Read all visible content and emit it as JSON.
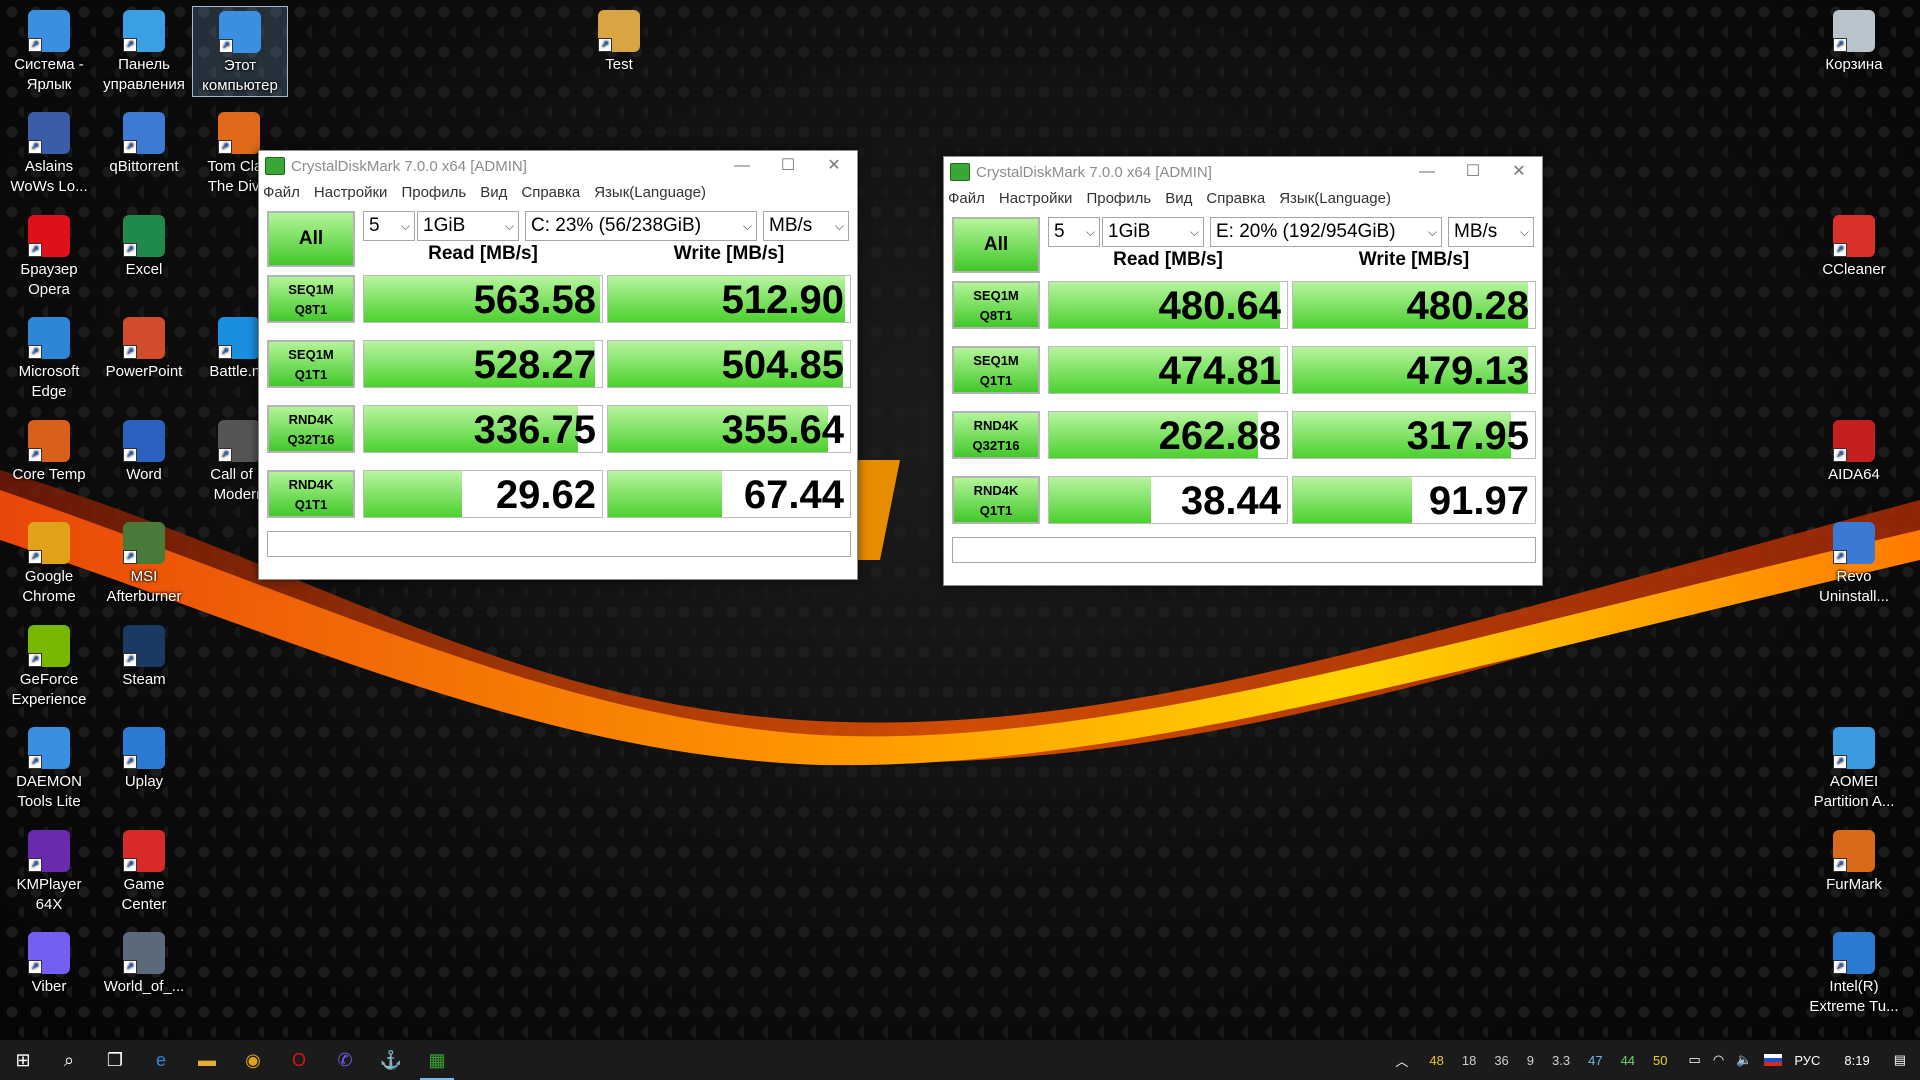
{
  "desktop": {
    "icons": [
      {
        "label": "Система - Ярлык",
        "icon": "computer-icon",
        "color": "#3b8fe0"
      },
      {
        "label": "Панель управления",
        "icon": "control-panel-icon",
        "color": "#3aa0e6"
      },
      {
        "label": "Этот компьютер",
        "icon": "this-pc-icon",
        "color": "#3b8fe0"
      },
      {
        "label": "Test",
        "icon": "folder-icon",
        "color": "#d9a441"
      },
      {
        "label": "Корзина",
        "icon": "recycle-bin-icon",
        "color": "#b9c4cc"
      },
      {
        "label": "Aslains WoWs Lo...",
        "icon": "aslains-icon",
        "color": "#3b5da8"
      },
      {
        "label": "qBittorrent",
        "icon": "qbittorrent-icon",
        "color": "#3b7bd4"
      },
      {
        "label": "Tom Clan The Divis",
        "icon": "division2-icon",
        "color": "#e06a1a"
      },
      {
        "label": "Браузер Opera",
        "icon": "opera-icon",
        "color": "#e0101a"
      },
      {
        "label": "Excel",
        "icon": "excel-icon",
        "color": "#1f8a4c"
      },
      {
        "label": "CCleaner",
        "icon": "ccleaner-icon",
        "color": "#d9302a"
      },
      {
        "label": "Microsoft Edge",
        "icon": "edge-icon",
        "color": "#2f86d6"
      },
      {
        "label": "PowerPoint",
        "icon": "powerpoint-icon",
        "color": "#d24b2a"
      },
      {
        "label": "Battle.ne",
        "icon": "battlenet-icon",
        "color": "#1a8fe0"
      },
      {
        "label": "Core Temp",
        "icon": "coretemp-icon",
        "color": "#d9601a"
      },
      {
        "label": "Word",
        "icon": "word-icon",
        "color": "#2b62c2"
      },
      {
        "label": "Call of D Modern",
        "icon": "cod-icon",
        "color": "#555555"
      },
      {
        "label": "AIDA64",
        "icon": "aida64-icon",
        "color": "#c42020"
      },
      {
        "label": "Google Chrome",
        "icon": "chrome-icon",
        "color": "#e0a21a"
      },
      {
        "label": "MSI Afterburner",
        "icon": "msi-afterburner-icon",
        "color": "#4a7a3a"
      },
      {
        "label": "Revo Uninstall...",
        "icon": "revo-icon",
        "color": "#3a7ad4"
      },
      {
        "label": "GeForce Experience",
        "icon": "geforce-icon",
        "color": "#76b900"
      },
      {
        "label": "Steam",
        "icon": "steam-icon",
        "color": "#1b3a63"
      },
      {
        "label": "DAEMON Tools Lite",
        "icon": "daemon-tools-icon",
        "color": "#3b8fe0"
      },
      {
        "label": "Uplay",
        "icon": "uplay-icon",
        "color": "#2a7ad4"
      },
      {
        "label": "AOMEI Partition A...",
        "icon": "aomei-icon",
        "color": "#3a9ae0"
      },
      {
        "label": "KMPlayer 64X",
        "icon": "kmplayer-icon",
        "color": "#6a2ab0"
      },
      {
        "label": "Game Center",
        "icon": "game-center-icon",
        "color": "#d92a2a"
      },
      {
        "label": "FurMark",
        "icon": "furmark-icon",
        "color": "#d96a1a"
      },
      {
        "label": "Viber",
        "icon": "viber-icon",
        "color": "#7360f2"
      },
      {
        "label": "World_of_...",
        "icon": "world-of-warships-icon",
        "color": "#5a6a7a"
      },
      {
        "label": "Intel(R) Extreme Tu...",
        "icon": "intel-xtu-icon",
        "color": "#2a7ad4"
      }
    ]
  },
  "windows": [
    {
      "title": "CrystalDiskMark 7.0.0 x64 [ADMIN]",
      "menu": [
        "Файл",
        "Настройки",
        "Профиль",
        "Вид",
        "Справка",
        "Язык(Language)"
      ],
      "all_label": "All",
      "count": "5",
      "size": "1GiB",
      "drive": "C: 23% (56/238GiB)",
      "unit": "MB/s",
      "read_header": "Read [MB/s]",
      "write_header": "Write [MB/s]",
      "rows": [
        {
          "l1": "SEQ1M",
          "l2": "Q8T1",
          "read": "563.58",
          "write": "512.90",
          "read_frac": 0.99,
          "write_frac": 0.98
        },
        {
          "l1": "SEQ1M",
          "l2": "Q1T1",
          "read": "528.27",
          "write": "504.85",
          "read_frac": 0.97,
          "write_frac": 0.97
        },
        {
          "l1": "RND4K",
          "l2": "Q32T16",
          "read": "336.75",
          "write": "355.64",
          "read_frac": 0.9,
          "write_frac": 0.91
        },
        {
          "l1": "RND4K",
          "l2": "Q1T1",
          "read": "29.62",
          "write": "67.44",
          "read_frac": 0.41,
          "write_frac": 0.47
        }
      ]
    },
    {
      "title": "CrystalDiskMark 7.0.0 x64 [ADMIN]",
      "menu": [
        "Файл",
        "Настройки",
        "Профиль",
        "Вид",
        "Справка",
        "Язык(Language)"
      ],
      "all_label": "All",
      "count": "5",
      "size": "1GiB",
      "drive": "E: 20% (192/954GiB)",
      "unit": "MB/s",
      "read_header": "Read [MB/s]",
      "write_header": "Write [MB/s]",
      "rows": [
        {
          "l1": "SEQ1M",
          "l2": "Q8T1",
          "read": "480.64",
          "write": "480.28",
          "read_frac": 0.97,
          "write_frac": 0.97
        },
        {
          "l1": "SEQ1M",
          "l2": "Q1T1",
          "read": "474.81",
          "write": "479.13",
          "read_frac": 0.97,
          "write_frac": 0.97
        },
        {
          "l1": "RND4K",
          "l2": "Q32T16",
          "read": "262.88",
          "write": "317.95",
          "read_frac": 0.88,
          "write_frac": 0.9
        },
        {
          "l1": "RND4K",
          "l2": "Q1T1",
          "read": "38.44",
          "write": "91.97",
          "read_frac": 0.43,
          "write_frac": 0.49
        }
      ]
    }
  ],
  "taskbar": {
    "apps": [
      "start-icon",
      "search-icon",
      "task-view-icon",
      "edge-icon",
      "explorer-icon",
      "chrome-icon",
      "opera-icon",
      "viber-icon",
      "world-of-warships-icon",
      "crystaldiskmark-icon"
    ],
    "tray_numbers": [
      "48",
      "18",
      "36",
      "9",
      "3.3",
      "47",
      "44",
      "50"
    ],
    "language": "РУС",
    "time": "8:19"
  }
}
